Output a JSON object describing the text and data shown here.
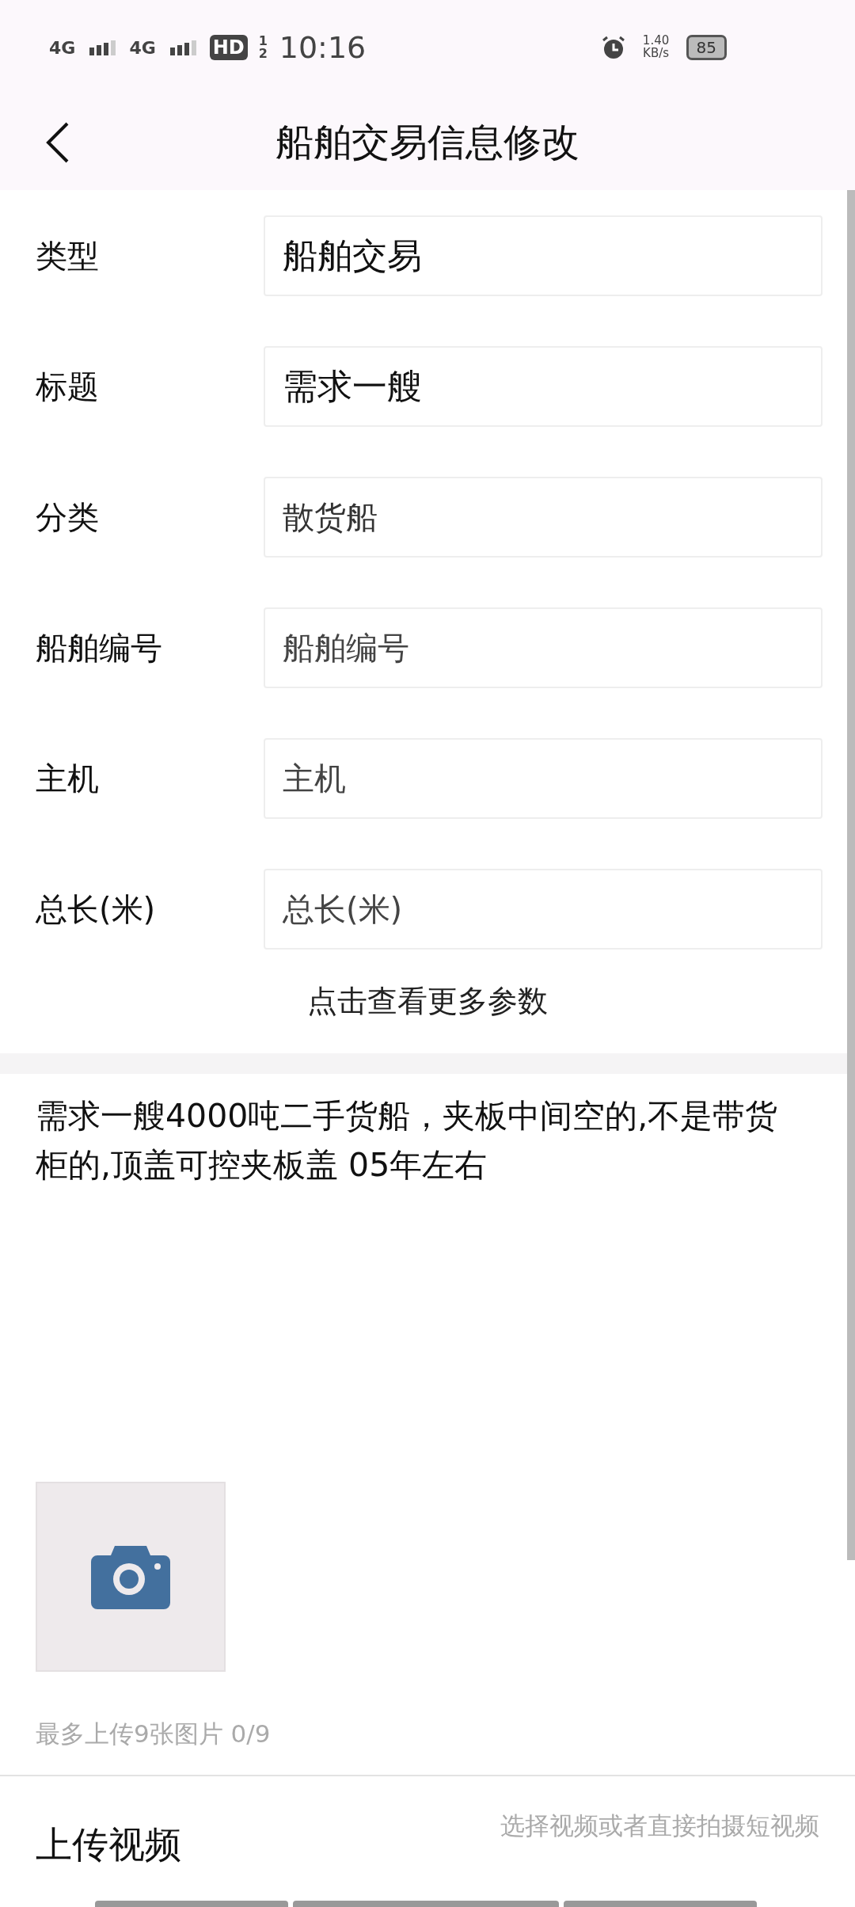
{
  "status_bar": {
    "network_1": "4G",
    "network_2": "4G",
    "hd": "HD",
    "sim": "12",
    "time": "10:16",
    "speed_value": "1.40",
    "speed_unit": "KB/s",
    "battery": "85"
  },
  "header": {
    "title": "船舶交易信息修改"
  },
  "fields": [
    {
      "label": "类型",
      "kind": "value",
      "text": "船舶交易"
    },
    {
      "label": "标题",
      "kind": "value",
      "text": "需求一艘"
    },
    {
      "label": "分类",
      "kind": "select",
      "text": "散货船"
    },
    {
      "label": "船舶编号",
      "kind": "placeholder",
      "placeholder": "船舶编号"
    },
    {
      "label": "主机",
      "kind": "placeholder",
      "placeholder": "主机"
    },
    {
      "label": "总长(米)",
      "kind": "placeholder",
      "placeholder": "总长(米)"
    }
  ],
  "more_link": "点击查看更多参数",
  "description": "需求一艘4000吨二手货船，夹板中间空的,不是带货柜的,顶盖可控夹板盖 05年左右",
  "photo_hint": "最多上传9张图片 0/9",
  "video": {
    "label": "上传视频",
    "hint": "选择视频或者直接拍摄短视频"
  }
}
